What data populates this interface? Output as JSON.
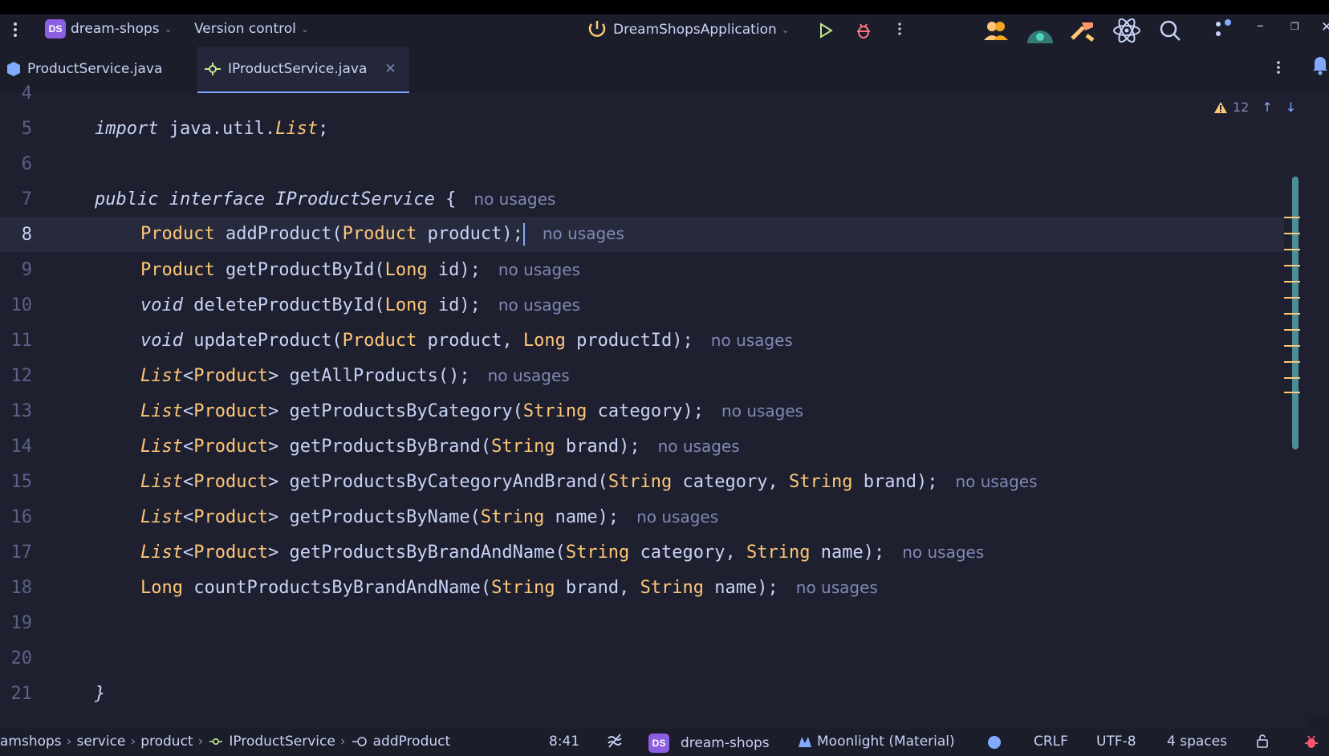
{
  "titlebar": {
    "project_badge": "DS",
    "project": "dream-shops",
    "vcs": "Version control",
    "run_config": "DreamShopsApplication"
  },
  "tabs": [
    {
      "label": "ProductService.java"
    },
    {
      "label": "IProductService.java"
    }
  ],
  "editor": {
    "warnings_count": "12",
    "hint": "no usages",
    "lines": {
      "n4": "4",
      "n5": "5",
      "n6": "6",
      "n7": "7",
      "n8": "8",
      "n9": "9",
      "n10": "10",
      "n11": "11",
      "n12": "12",
      "n13": "13",
      "n14": "14",
      "n15": "15",
      "n16": "16",
      "n17": "17",
      "n18": "18",
      "n19": "19",
      "n20": "20",
      "n21": "21"
    },
    "code": {
      "import_kw": "import",
      "import_pkg": "java.util.",
      "import_cls": "List",
      "import_end": ";",
      "public": "public",
      "interface": "interface",
      "iface_name": "IProductService",
      "open_brace": "{",
      "close_brace": "}",
      "Product": "Product",
      "List": "List",
      "void": "void",
      "Long": "Long",
      "String": "String",
      "l8": [
        "addProduct(",
        "product);"
      ],
      "l9": [
        "getProductById(",
        "id);"
      ],
      "l10": [
        "deleteProductById(",
        "id);"
      ],
      "l11": [
        "updateProduct(",
        "product, ",
        "productId);"
      ],
      "l12": [
        "getAllProducts();"
      ],
      "l13": [
        "getProductsByCategory(",
        "category);"
      ],
      "l14": [
        "getProductsByBrand(",
        "brand);"
      ],
      "l15": [
        "getProductsByCategoryAndBrand(",
        "category, ",
        "brand);"
      ],
      "l16": [
        "getProductsByName(",
        "name);"
      ],
      "l17": [
        "getProductsByBrandAndName(",
        "category, ",
        "name);"
      ],
      "l18": [
        "countProductsByBrandAndName(",
        "brand, ",
        "name);"
      ]
    }
  },
  "status": {
    "breadcrumb": [
      "amshops",
      "service",
      "product",
      "IProductService",
      "addProduct"
    ],
    "position": "8:41",
    "project_badge": "DS",
    "project": "dream-shops",
    "theme": "Moonlight (Material)",
    "line_sep": "CRLF",
    "encoding": "UTF-8",
    "indent": "4 spaces"
  },
  "colors": {
    "background": "#1e2030",
    "type": "#ffc777",
    "accent": "#82aaff",
    "hint": "#8088b4"
  }
}
